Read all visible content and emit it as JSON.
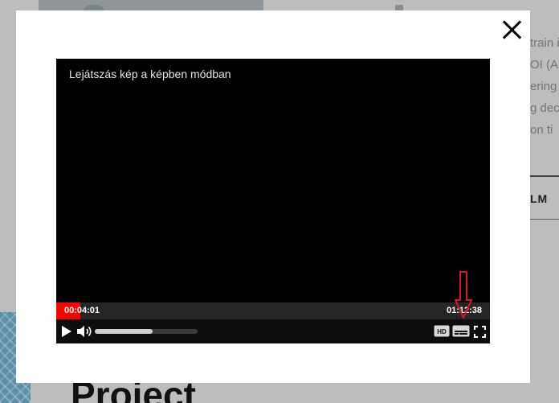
{
  "background": {
    "text_lines": [
      "train i",
      "OI (A",
      "ering",
      "g dec",
      "on ti"
    ],
    "link_label": "LM",
    "heading": "Project"
  },
  "modal": {
    "close_icon": "close-icon"
  },
  "player": {
    "overlay_text": "Lejátszás kép a képben módban",
    "current_time": "00:04:01",
    "total_time": "01:12:38",
    "progress_fraction": 0.055,
    "volume_fraction": 0.56,
    "hd_label": "HD",
    "accent_color": "#ff0000"
  },
  "annotation": {
    "color": "#e0161e",
    "icon": "down-arrow-icon"
  }
}
